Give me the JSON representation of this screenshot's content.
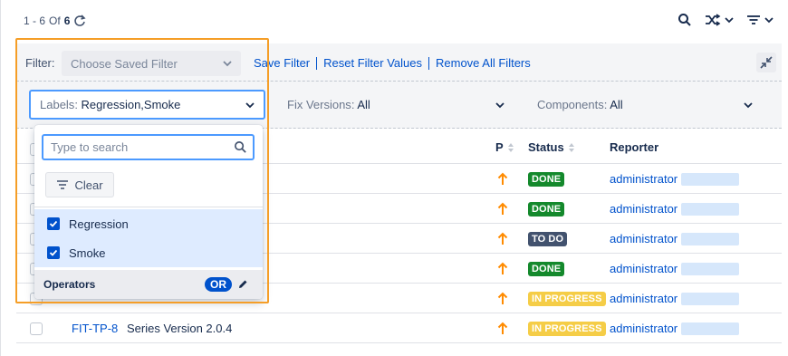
{
  "pager": {
    "prefix": "1 - 6",
    "of": "Of",
    "total": "6"
  },
  "filter": {
    "label": "Filter:",
    "saved_placeholder": "Choose Saved Filter",
    "links": [
      "Save Filter",
      "Reset Filter Values",
      "Remove All Filters"
    ]
  },
  "criteria": {
    "labels": {
      "key": "Labels",
      "value": "Regression,Smoke"
    },
    "fix_versions": {
      "key": "Fix Versions",
      "value": "All"
    },
    "components": {
      "key": "Components",
      "value": "All"
    }
  },
  "dropdown": {
    "search_placeholder": "Type to search",
    "clear_label": "Clear",
    "options": [
      {
        "label": "Regression",
        "checked": true
      },
      {
        "label": "Smoke",
        "checked": true
      }
    ],
    "operators_label": "Operators",
    "operator_value": "OR"
  },
  "table": {
    "headers": {
      "priority": "P",
      "status": "Status",
      "reporter": "Reporter"
    },
    "rows": [
      {
        "key": "",
        "summary": "",
        "status": "DONE",
        "reporter": "administrator"
      },
      {
        "key": "",
        "summary": "",
        "status": "DONE",
        "reporter": "administrator"
      },
      {
        "key": "",
        "summary": "",
        "status": "TO DO",
        "reporter": "administrator"
      },
      {
        "key": "",
        "summary": "",
        "status": "DONE",
        "reporter": "administrator"
      },
      {
        "key": "",
        "summary": "",
        "status": "IN PROGRESS",
        "reporter": "administrator"
      },
      {
        "key": "FIT-TP-8",
        "summary": "Series Version 2.0.4",
        "status": "IN PROGRESS",
        "reporter": "administrator"
      }
    ]
  },
  "colors": {
    "done": "#14892c",
    "todo": "#42526e",
    "in_progress": "#f5cd47",
    "priority": "#ff8b00",
    "highlight": "#f59e27",
    "link": "#0052cc"
  }
}
